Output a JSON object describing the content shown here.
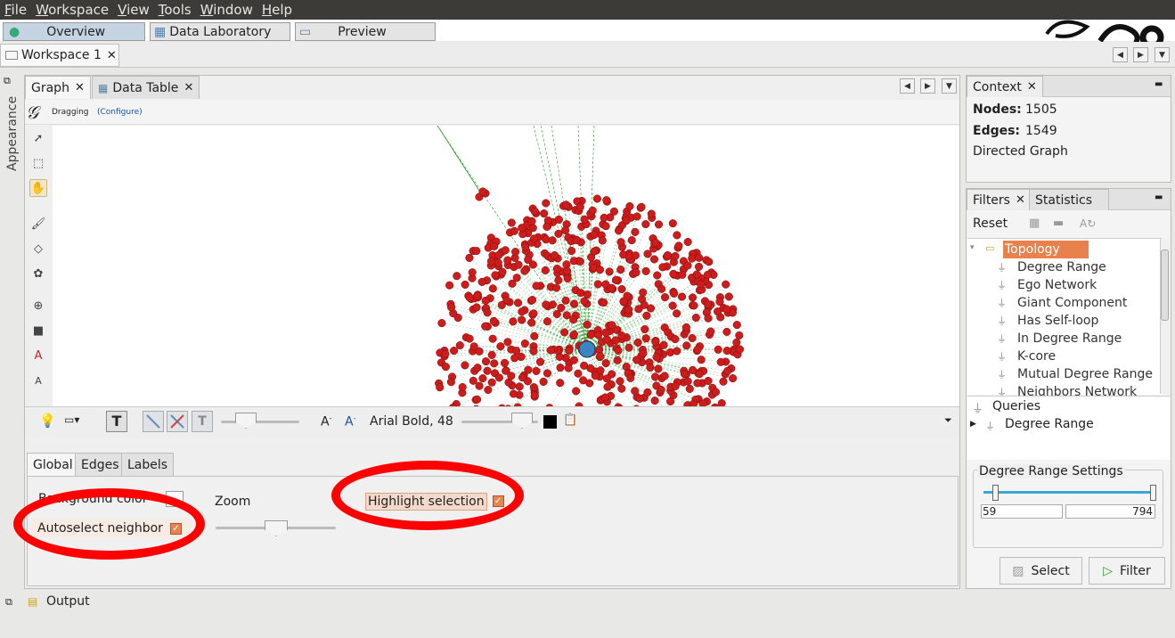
{
  "menubar": [
    "File",
    "Workspace",
    "View",
    "Tools",
    "Window",
    "Help"
  ],
  "top_tabs": {
    "overview": "Overview",
    "data_laboratory": "Data Laboratory",
    "preview": "Preview"
  },
  "workspace_tab": "Workspace 1",
  "side_label": "Appearance",
  "graph_tabs": {
    "graph": "Graph",
    "data_table": "Data Table"
  },
  "toolbar": {
    "mode": "Dragging",
    "configure": "(Configure)"
  },
  "bottom_toolbar": {
    "font": "Arial Bold, 48",
    "text_icon": "T"
  },
  "settings_tabs": {
    "global": "Global",
    "edges": "Edges",
    "labels": "Labels"
  },
  "settings": {
    "background_color": "Background color",
    "autoselect_neighbor": "Autoselect neighbor",
    "zoom": "Zoom",
    "highlight_selection": "Highlight selection"
  },
  "context": {
    "title": "Context",
    "nodes_label": "Nodes:",
    "nodes": "1505",
    "edges_label": "Edges:",
    "edges": "1549",
    "graph_type": "Directed Graph"
  },
  "filters": {
    "tab_filters": "Filters",
    "tab_statistics": "Statistics",
    "reset": "Reset",
    "topology": "Topology",
    "items": [
      "Degree Range",
      "Ego Network",
      "Giant Component",
      "Has Self-loop",
      "In Degree Range",
      "K-core",
      "Mutual Degree Range",
      "Neighbors Network"
    ],
    "queries": "Queries",
    "query_item": "Degree Range",
    "settings_title": "Degree Range Settings",
    "range_min": "59",
    "range_max": "794",
    "select": "Select",
    "filter": "Filter"
  },
  "output": "Output",
  "colors": {
    "node": "#cc1c1c",
    "center": "#3a85c2",
    "edge": "#2e9a2e",
    "highlight": "#e07040",
    "annotation": "#ff0000"
  }
}
